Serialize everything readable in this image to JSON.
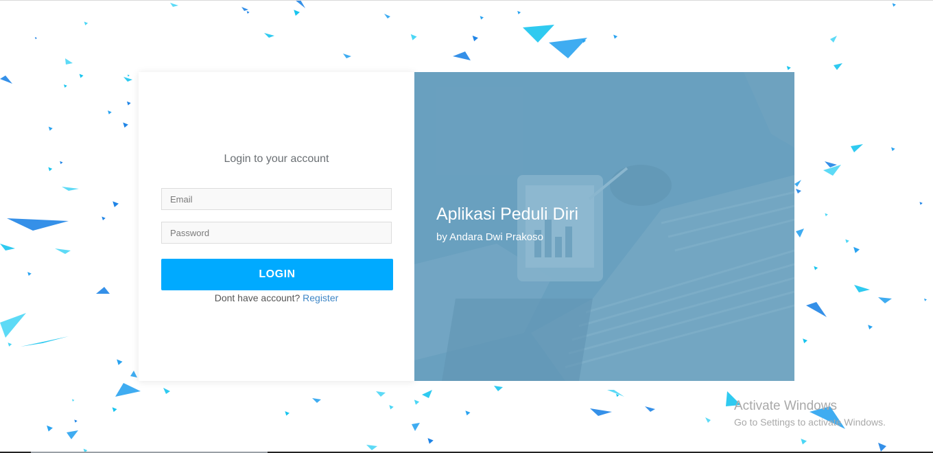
{
  "login": {
    "title": "Login to your account",
    "email_placeholder": "Email",
    "password_placeholder": "Password",
    "button_label": "LOGIN",
    "register_prompt": "Dont have account?",
    "register_link": "Register"
  },
  "hero": {
    "title": "Aplikasi Peduli Diri",
    "subtitle": "by Andara Dwi Prakoso"
  },
  "watermark": {
    "title": "Activate Windows",
    "subtitle": "Go to Settings to activate Windows."
  },
  "colors": {
    "accent": "#00aaff",
    "link": "#3d86c6",
    "hero_tint": "#6ea2c0",
    "confetti": [
      "#18c4ee",
      "#2aa3f0",
      "#1f84e6",
      "#4bd6f5"
    ]
  }
}
